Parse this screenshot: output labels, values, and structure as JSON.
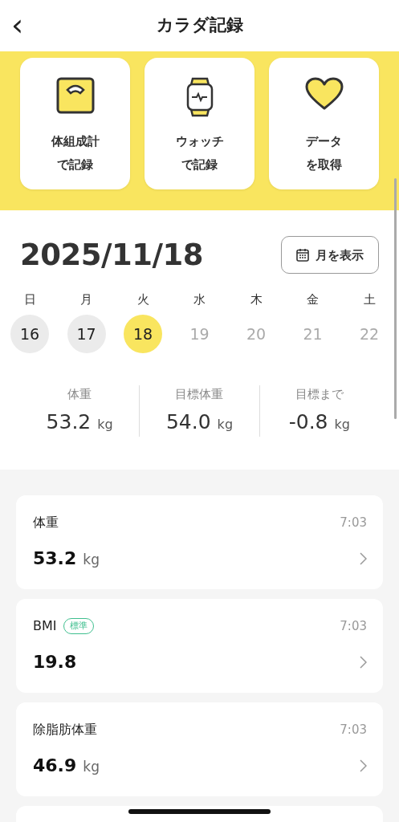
{
  "header": {
    "title": "カラダ記録",
    "back": "‹"
  },
  "actions": [
    {
      "kind": "scale",
      "line1": "体組成計",
      "line2": "で記録"
    },
    {
      "kind": "watch",
      "line1": "ウォッチ",
      "line2": "で記録"
    },
    {
      "kind": "heart",
      "line1": "データ",
      "line2": "を取得"
    }
  ],
  "date": "2025/11/18",
  "month_button": "月を表示",
  "days": [
    {
      "weekday": "日",
      "day": "16",
      "selected": false,
      "disabled": false
    },
    {
      "weekday": "月",
      "day": "17",
      "selected": false,
      "disabled": false
    },
    {
      "weekday": "火",
      "day": "18",
      "selected": true,
      "disabled": false
    },
    {
      "weekday": "水",
      "day": "19",
      "selected": false,
      "disabled": true
    },
    {
      "weekday": "木",
      "day": "20",
      "selected": false,
      "disabled": true
    },
    {
      "weekday": "金",
      "day": "21",
      "selected": false,
      "disabled": true
    },
    {
      "weekday": "土",
      "day": "22",
      "selected": false,
      "disabled": true
    }
  ],
  "stats": [
    {
      "label": "体重",
      "value": "53.2",
      "unit": "kg"
    },
    {
      "label": "目標体重",
      "value": "54.0",
      "unit": "kg"
    },
    {
      "label": "目標まで",
      "value": "-0.8",
      "unit": "kg"
    }
  ],
  "records": [
    {
      "label": "体重",
      "time": "7:03",
      "value": "53.2",
      "unit": "kg"
    },
    {
      "label": "BMI",
      "badge": "標準",
      "color": "#3fbf8f",
      "time": "7:03",
      "value": "19.8"
    },
    {
      "label": "除脂肪体重",
      "time": "7:03",
      "value": "46.9",
      "unit": "kg"
    }
  ]
}
